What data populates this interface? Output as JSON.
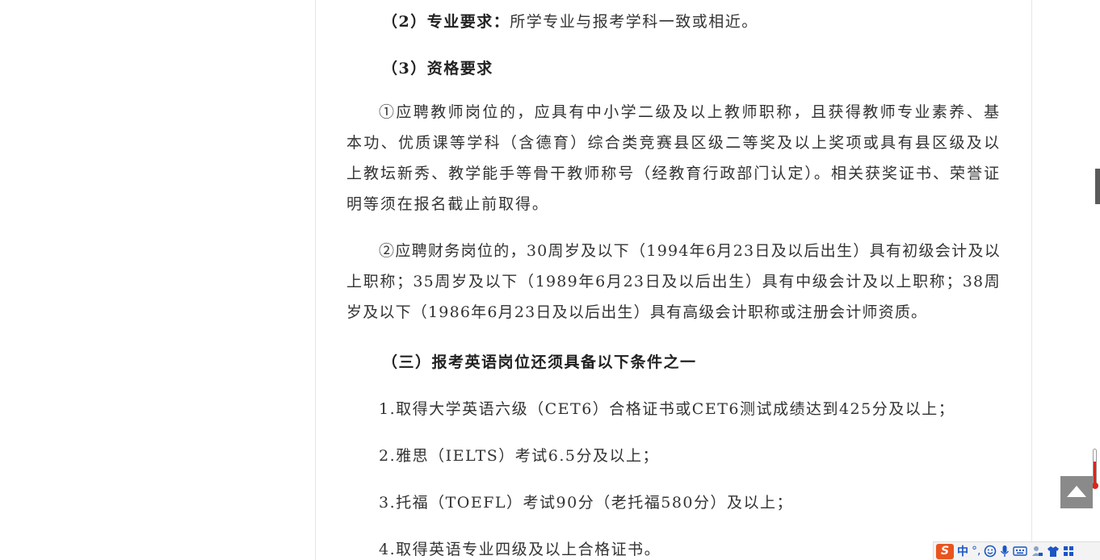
{
  "document": {
    "line_major_req": {
      "label": "（2）专业要求：",
      "text": "所学专业与报考学科一致或相近。"
    },
    "heading_qualification": "（3）资格要求",
    "para_teacher": "①应聘教师岗位的，应具有中小学二级及以上教师职称，且获得教师专业素养、基本功、优质课等学科（含德育）综合类竞赛县区级二等奖及以上奖项或具有县区级及以上教坛新秀、教学能手等骨干教师称号（经教育行政部门认定）。相关获奖证书、荣誉证明等须在报名截止前取得。",
    "para_finance": "②应聘财务岗位的，30周岁及以下（1994年6月23日及以后出生）具有初级会计及以上职称；35周岁及以下（1989年6月23日及以后出生）具有中级会计及以上职称；38周岁及以下（1986年6月23日及以后出生）具有高级会计职称或注册会计师资质。",
    "heading_english": "（三）报考英语岗位还须具备以下条件之一",
    "english_items": [
      "1.取得大学英语六级（CET6）合格证书或CET6测试成绩达到425分及以上；",
      "2.雅思（IELTS）考试6.5分及以上；",
      "3.托福（TOEFL）考试90分（老托福580分）及以上；",
      "4.取得英语专业四级及以上合格证书。"
    ]
  },
  "widgets": {
    "back_to_top_icon": "triangle-up-icon",
    "ime": {
      "logo": "S",
      "mode": "中",
      "punct": "°,",
      "icons": [
        "smiley-icon",
        "microphone-icon",
        "keyboard-icon",
        "user-icon",
        "shirt-icon",
        "grid-icon"
      ]
    }
  },
  "colors": {
    "text": "#333333",
    "ime_accent": "#e9541f",
    "back_to_top_bg": "#8a8a8a"
  }
}
